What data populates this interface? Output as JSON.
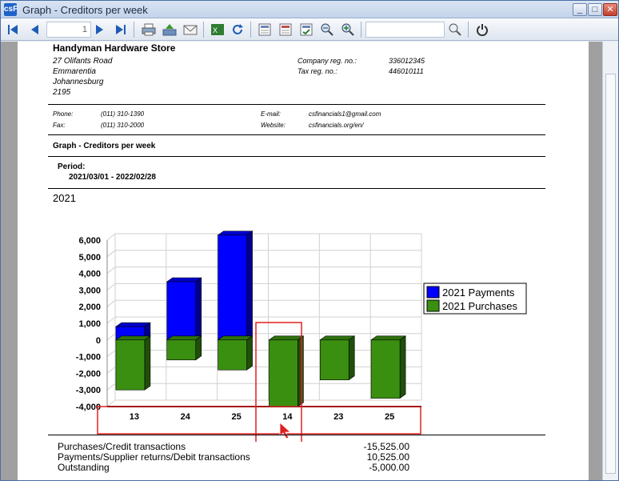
{
  "window": {
    "title": "Graph - Creditors per week",
    "app_icon": "csF"
  },
  "toolbar": {
    "page_number": "1",
    "search_placeholder": ""
  },
  "report": {
    "company": "Handyman Hardware Store",
    "address": [
      "27 Olifants Road",
      "Emmarentia",
      "Johannesburg",
      "2195"
    ],
    "company_reg_label": "Company reg. no.:",
    "company_reg_value": "336012345",
    "tax_reg_label": "Tax reg. no.:",
    "tax_reg_value": "446010111",
    "phone_label": "Phone:",
    "phone_value": "(011) 310-1390",
    "fax_label": "Fax:",
    "fax_value": "(011) 310-2000",
    "email_label": "E-mail:",
    "email_value": "csfinancials1@gmail.com",
    "website_label": "Website:",
    "website_value": "csfinancials.org/en/",
    "report_title": "Graph - Creditors per week",
    "period_label": "Period:",
    "period_value": "2021/03/01  -   2022/02/28",
    "year": "2021"
  },
  "chart_data": {
    "type": "bar",
    "categories": [
      "13",
      "24",
      "25",
      "14",
      "23",
      "25"
    ],
    "series": [
      {
        "name": "2021 Payments",
        "color": "#0000ff",
        "values": [
          800,
          3500,
          6300,
          0,
          0,
          0
        ]
      },
      {
        "name": "2021 Purchases",
        "color": "#3a8f10",
        "values": [
          -3000,
          -1200,
          -1800,
          -4000,
          -2400,
          -3500
        ]
      }
    ],
    "yticks": [
      "6,000",
      "5,000",
      "4,000",
      "3,000",
      "2,000",
      "1,000",
      "0",
      "-1,000",
      "-2,000",
      "-3,000",
      "-4,000"
    ],
    "ylim": [
      -4000,
      6000
    ],
    "grid": true,
    "legend": "right"
  },
  "summary": [
    {
      "label": "Purchases/Credit transactions",
      "value": "-15,525.00"
    },
    {
      "label": "Payments/Supplier returns/Debit transactions",
      "value": "10,525.00"
    },
    {
      "label": "Outstanding",
      "value": "-5,000.00"
    }
  ]
}
